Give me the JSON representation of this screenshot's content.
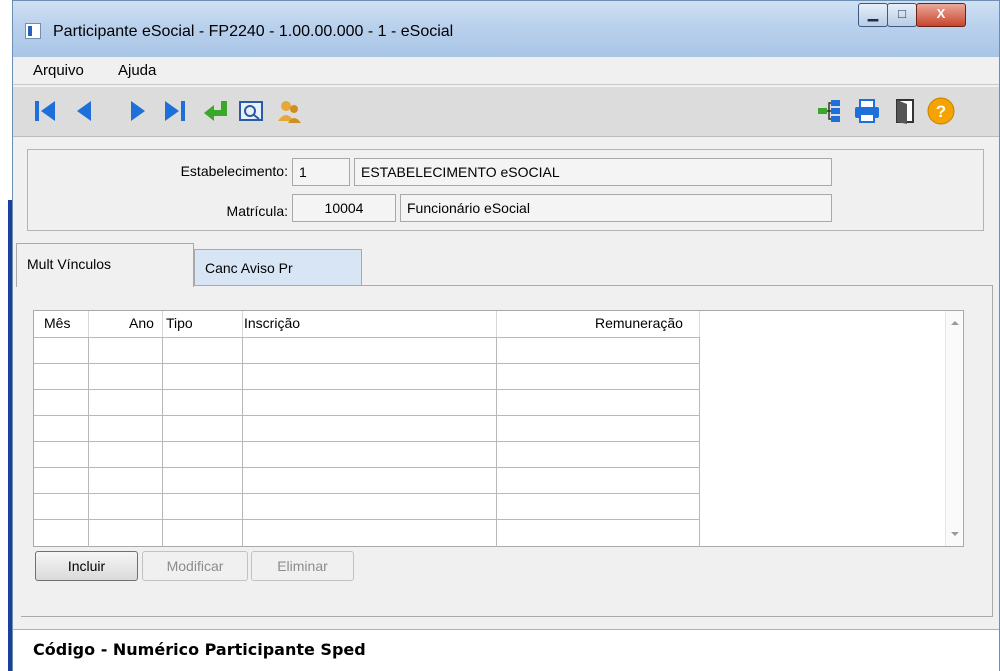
{
  "window": {
    "title": "Participante eSocial - FP2240 - 1.00.00.000 - 1 - eSocial",
    "controls": {
      "minimize": "▁",
      "maximize": "□",
      "close": "X"
    }
  },
  "menu": {
    "items": [
      {
        "label": "Arquivo"
      },
      {
        "label": "Ajuda"
      }
    ]
  },
  "toolbar": {
    "left_icons": [
      "first-record-icon",
      "previous-record-icon",
      "next-record-icon",
      "last-record-icon",
      "go-to-icon",
      "search-icon",
      "users-icon"
    ],
    "right_icons": [
      "tree-icon",
      "printer-icon",
      "exit-door-icon",
      "help-icon"
    ],
    "help_glyph": "?"
  },
  "header": {
    "estabelecimento_label": "Estabelecimento:",
    "estabelecimento_code": "1",
    "estabelecimento_name": "ESTABELECIMENTO eSOCIAL",
    "matricula_label": "Matrícula:",
    "matricula_code": "10004",
    "matricula_name": "Funcionário eSocial"
  },
  "tabs": [
    {
      "label": "Mult Vínculos",
      "active": true
    },
    {
      "label": "Canc Aviso Pr",
      "active": false
    }
  ],
  "grid": {
    "columns": [
      "Mês",
      "Ano",
      "Tipo",
      "Inscrição",
      "Remuneração"
    ],
    "rows": []
  },
  "buttons": {
    "incluir": "Incluir",
    "modificar": "Modificar",
    "eliminar": "Eliminar"
  },
  "status": {
    "text": "Código - Numérico Participante Sped"
  },
  "colors": {
    "titlebar": "#b9d1ec",
    "nav_arrows": "#1e6fd9",
    "close_button": "#c9452d",
    "help_circle": "#f5a300"
  }
}
